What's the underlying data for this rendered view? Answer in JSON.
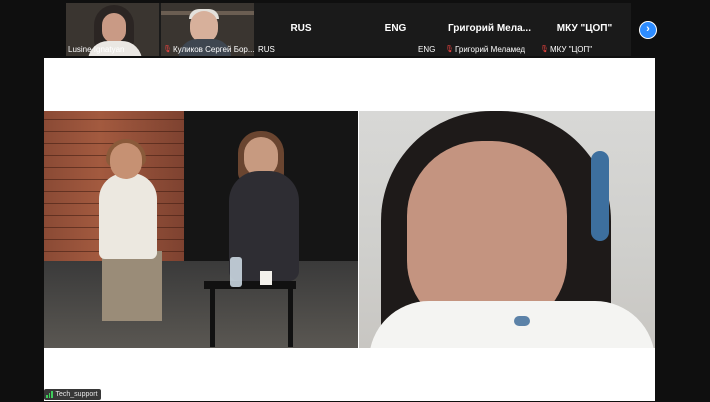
{
  "participants": [
    {
      "name": "Lusine Ignatyan",
      "video": true,
      "muted": false
    },
    {
      "name": "Куликов Сергей Бор...",
      "video": true,
      "muted": true
    },
    {
      "display_name": "RUS",
      "name": "RUS",
      "video": false,
      "muted": false
    },
    {
      "display_name": "ENG",
      "name": "ENG",
      "video": false,
      "muted": false
    },
    {
      "display_name": "Григорий  Мела...",
      "name": "Григорий Меламед",
      "video": false,
      "muted": true
    },
    {
      "display_name": "МКУ \"ЦОП\"",
      "name": "МКУ \"ЦОП\"",
      "video": false,
      "muted": true
    }
  ],
  "controls": {
    "next_page_icon": "chevron-right-icon"
  },
  "shared_screen": {
    "label": "Tech_support"
  },
  "colors": {
    "accent": "#2d8cff",
    "muted": "#e8423f"
  }
}
